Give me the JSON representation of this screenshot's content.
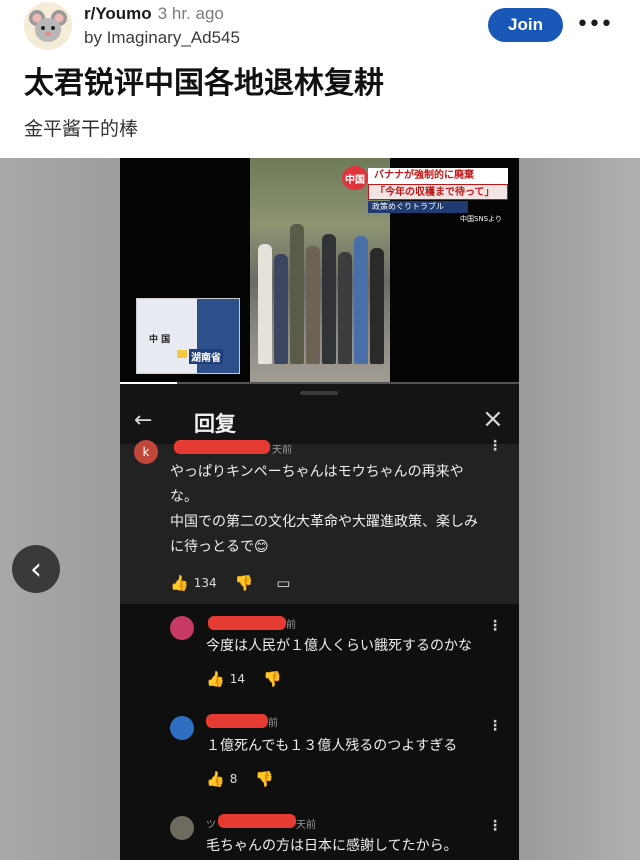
{
  "header": {
    "subreddit": "r/Youmo",
    "time": "3 hr. ago",
    "author": "by Imaginary_Ad545",
    "join_label": "Join",
    "more_icon": "more-horizontal-icon",
    "accent": "#1958b7"
  },
  "post": {
    "title": "太君锐评中国各地退林复耕",
    "body": "金平酱干的棒"
  },
  "video": {
    "news_badge": "中国",
    "headline_1": "バナナが強制的に廃棄",
    "headline_2": "「今年の収穫まで待って」",
    "subtitle": "政策めぐりトラブル",
    "source": "中国SNSより",
    "map_country": "中 国",
    "map_province": "湖南省"
  },
  "replies_panel": {
    "title": "回复",
    "back_icon": "arrow-left-icon",
    "close_icon": "close-icon"
  },
  "comments": [
    {
      "avatar_letter": "k",
      "meta": "天前",
      "lines": [
        "やっぱりキンペーちゃんはモウちゃんの再来や",
        "な。",
        "中国での第二の文化大革命や大躍進政策、楽しみ",
        "に待っとるで😊"
      ],
      "likes": "134"
    },
    {
      "meta": "前",
      "lines": [
        "今度は人民が１億人くらい餓死するのかな"
      ],
      "likes": "14"
    },
    {
      "meta": "前",
      "lines": [
        "１億死んでも１３億人残るのつよすぎる"
      ],
      "likes": "8"
    },
    {
      "meta_prefix": "ツ",
      "meta": "天前",
      "lines": [
        "毛ちゃんの方は日本に感謝してたから。"
      ]
    }
  ],
  "nav": {
    "back_chevron": "‹"
  }
}
